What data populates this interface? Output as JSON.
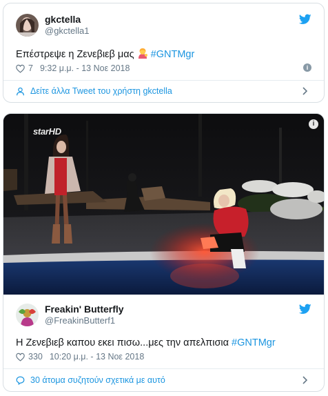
{
  "tweets": [
    {
      "display_name": "gkctella",
      "handle": "@gkctella1",
      "text_prefix": "Επέστρεψε η Ζενεβιεβ μας ",
      "emoji_icon": "woman-tipping-hand-icon",
      "hashtag": "#GNTMgr",
      "likes": "7",
      "timestamp": "9:32 μ.μ. - 13 Νοε 2018",
      "footer": "Δείτε άλλα Tweet του χρήστη gkctella",
      "footer_icon": "user-icon"
    },
    {
      "display_name": "Freakin' Butterfly",
      "handle": "@FreakinButterf1",
      "text_prefix": "Η Ζενεβιεβ καπου εκει πισω...μες την απελπισια ",
      "hashtag": "#GNTMgr",
      "likes": "330",
      "timestamp": "10:20 μ.μ. - 13 Νοε 2018",
      "footer": "30 άτομα συζητούν σχετικά με αυτό",
      "footer_icon": "speech-bubble-icon",
      "media": {
        "watermark": "starHD"
      }
    }
  ],
  "colors": {
    "link": "#1b95e0",
    "text": "#14171a",
    "secondary": "#657786",
    "border": "#d8dee3"
  }
}
